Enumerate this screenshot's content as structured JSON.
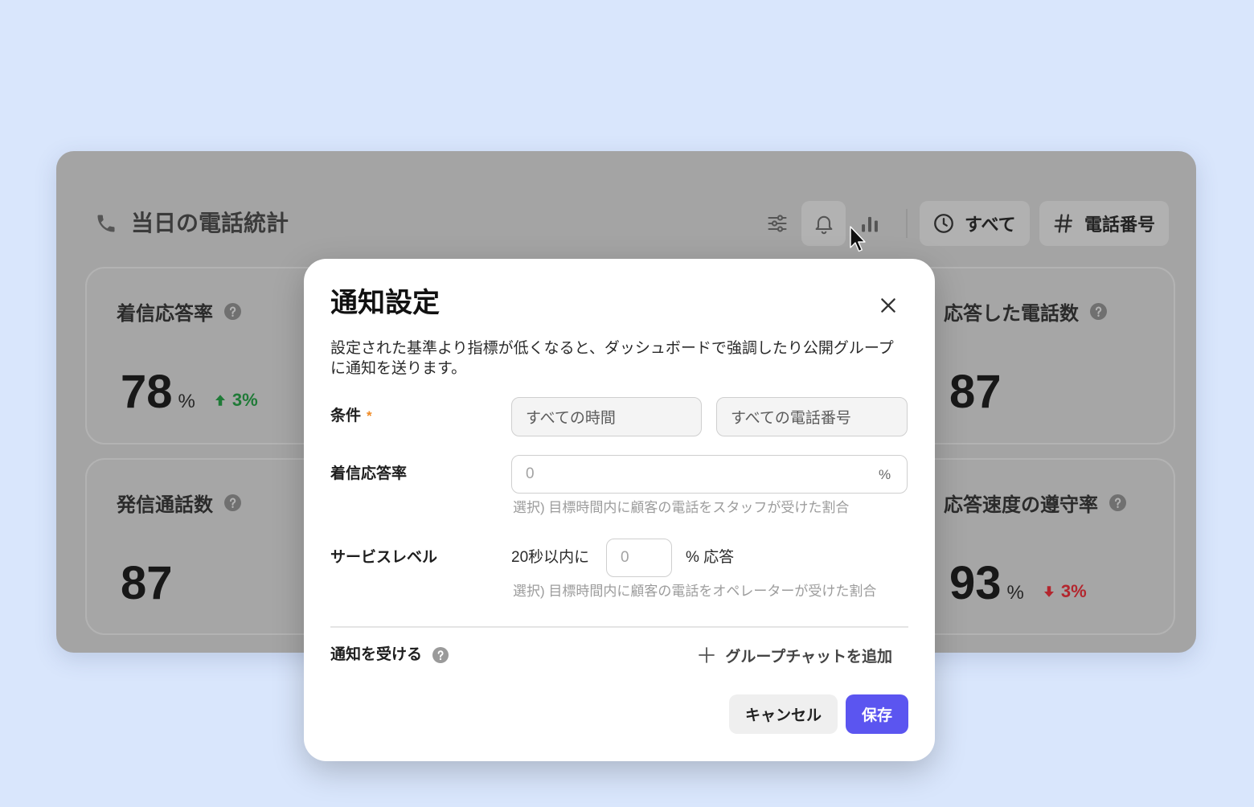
{
  "colors": {
    "accent": "#5b55f0",
    "up": "#1f7a37",
    "down": "#b3262e",
    "required": "#f08a24",
    "page_bg": "#d9e6fc"
  },
  "dashboard": {
    "title": "当日の電話統計",
    "title_icon": "phone-icon",
    "toolbar_icons": [
      "sliders-icon",
      "bell-icon",
      "bar-chart-icon"
    ],
    "filters": {
      "time": {
        "icon": "clock-icon",
        "label": "すべて"
      },
      "phone": {
        "icon": "hash-icon",
        "label": "電話番号"
      }
    },
    "stats": [
      {
        "label": "着信応答率",
        "value": "78",
        "unit": "%",
        "change": "3%",
        "change_icon": "arrow-up-icon"
      },
      {
        "label": "応答した電話数",
        "value": "87"
      },
      {
        "label": "発信通話数",
        "value": "87"
      },
      {
        "label": "応答速度の遵守率",
        "value": "93",
        "unit": "%",
        "change": "3%",
        "change_icon": "arrow-down-icon"
      }
    ]
  },
  "modal": {
    "title": "通知設定",
    "description": "設定された基準より指標が低くなると、ダッシュボードで強調したり公開グループに通知を送ります。",
    "condition": {
      "label": "条件",
      "required_mark": "*",
      "time_value": "すべての時間",
      "phone_value": "すべての電話番号"
    },
    "answer_rate": {
      "label": "着信応答率",
      "placeholder": "0",
      "suffix": "%",
      "help": "選択) 目標時間内に顧客の電話をスタッフが受けた割合"
    },
    "service_level": {
      "label": "サービスレベル",
      "prefix": "20秒以内に",
      "placeholder": "0",
      "suffix": "% 応答",
      "help": "選択) 目標時間内に顧客の電話をオペレーターが受けた割合"
    },
    "notify": {
      "label": "通知を受ける",
      "add_label": "グループチャットを追加"
    },
    "buttons": {
      "cancel": "キャンセル",
      "save": "保存"
    }
  }
}
